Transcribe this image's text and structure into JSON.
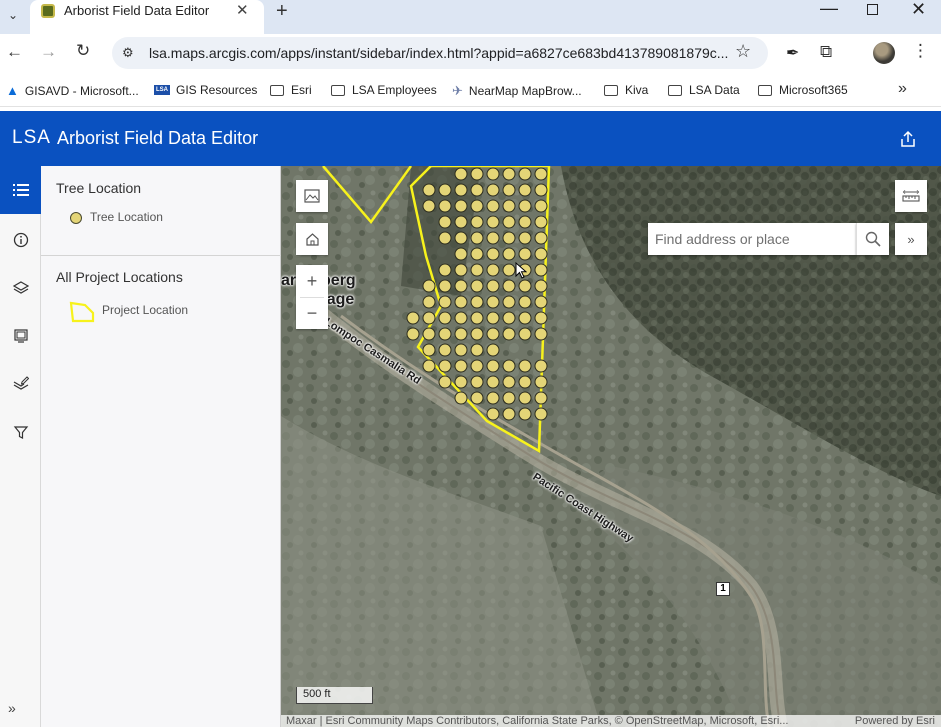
{
  "browser": {
    "tab_title": "Arborist Field Data Editor",
    "tab_close": "✕",
    "new_tab": "+",
    "url": "lsa.maps.arcgis.com/apps/instant/sidebar/index.html?appid=a6827ce683bd413789081879c...",
    "window": {
      "minimize": "—",
      "close": "✕"
    },
    "bookmarks": [
      {
        "label": "GISAVD - Microsoft...",
        "icon": "azure-icon"
      },
      {
        "label": "GIS Resources",
        "icon": "lsa-badge-icon"
      },
      {
        "label": "Esri",
        "icon": "folder-icon"
      },
      {
        "label": "LSA Employees",
        "icon": "folder-icon"
      },
      {
        "label": "NearMap MapBrow...",
        "icon": "nearmap-icon"
      },
      {
        "label": "Kiva",
        "icon": "folder-icon"
      },
      {
        "label": "LSA Data",
        "icon": "folder-icon"
      },
      {
        "label": "Microsoft365",
        "icon": "folder-icon"
      }
    ],
    "lsa_badge_text": "LSA"
  },
  "app": {
    "logo": "LSA",
    "title": "Arborist Field Data Editor"
  },
  "legend": {
    "sections": [
      {
        "title": "Tree Location",
        "item_label": "Tree Location",
        "symbol": "point",
        "color": "#e4d577"
      },
      {
        "title": "All Project Locations",
        "item_label": "Project Location",
        "symbol": "polygon",
        "color": "#f7f21c"
      }
    ]
  },
  "map": {
    "search_placeholder": "Find address or place",
    "scale_label": "500 ft",
    "attribution": "Maxar | Esri Community Maps Contributors, California State Parks, © OpenStreetMap, Microsoft, Esri...",
    "powered_by": "Powered by Esri",
    "labels": {
      "place": "arrenberg",
      "place2": "Village",
      "road1": "Lompoc Casmalia Rd",
      "road2": "Pacific Coast Highway",
      "route_shield": "1"
    },
    "zoom_in": "+",
    "zoom_out": "−"
  },
  "colors": {
    "accent": "#0a51c0",
    "tree_point": "#e4d577",
    "project_outline": "#f7f21c"
  }
}
